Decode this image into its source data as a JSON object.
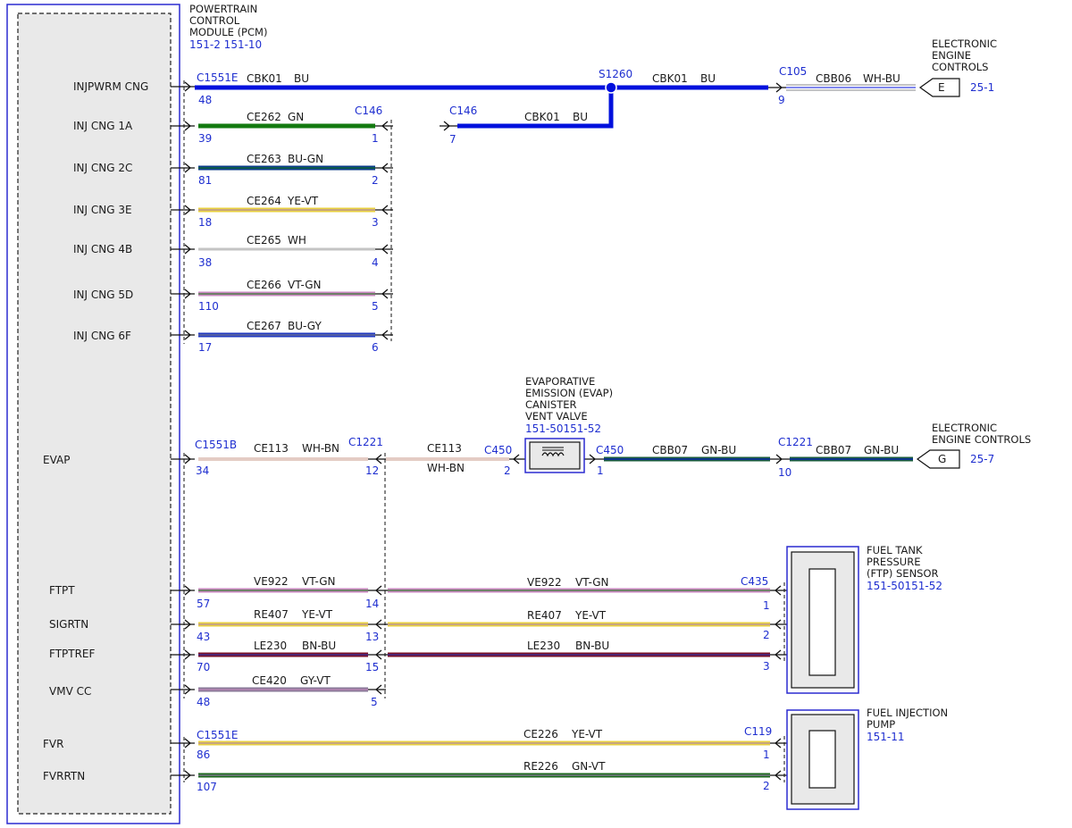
{
  "colors": {
    "blue": "#0010dd",
    "green": "#137a10",
    "blue_green": "#0a3a8a",
    "yellow": "#e8d040",
    "white": "#aaaaaa",
    "violet_green": "#c988c0",
    "blue_gray": "#2038c0",
    "white_brown": "#c89a88",
    "green_blue": "#1a5c3c",
    "brown_blue": "#7a1028",
    "gray_violet": "#8a7a98",
    "green_violet": "#1c6a1c",
    "label_blue": "#1f2fd0"
  },
  "pcm": {
    "title": [
      "POWERTRAIN",
      "CONTROL",
      "MODULE (PCM)"
    ],
    "ref": "151-2  151-10",
    "signals": [
      {
        "label": "INJPWRM CNG"
      },
      {
        "label": "INJ CNG 1A"
      },
      {
        "label": "INJ CNG 2C"
      },
      {
        "label": "INJ CNG 3E"
      },
      {
        "label": "INJ CNG 4B"
      },
      {
        "label": "INJ CNG 5D"
      },
      {
        "label": "INJ CNG 6F"
      },
      {
        "label": "EVAP"
      },
      {
        "label": "FTPT"
      },
      {
        "label": "SIGRTN"
      },
      {
        "label": "FTPTREF"
      },
      {
        "label": "VMV CC"
      },
      {
        "label": "FVR"
      },
      {
        "label": "FVRRTN"
      }
    ]
  },
  "connectors": {
    "c1551e_top": "C1551E",
    "c146_left": "C146",
    "c146_mid": "C146",
    "s1260": "S1260",
    "c105": "C105",
    "c1551b": "C1551B",
    "c1221_left": "C1221",
    "c450_left": "C450",
    "c450_right": "C450",
    "c1221_right": "C1221",
    "c435": "C435",
    "c1551e_bottom": "C1551E",
    "c119": "C119"
  },
  "wires": {
    "w1_left": {
      "circuit": "CBK01",
      "color": "BU",
      "pin": "48"
    },
    "w1_mid": {
      "circuit": "CBK01",
      "color": "BU"
    },
    "w1_right": {
      "circuit": "CBB06",
      "color": "WH-BU",
      "pin": "9"
    },
    "w1_branch": {
      "circuit": "CBK01",
      "color": "BU",
      "pin": "7"
    },
    "w2": {
      "circuit": "CE262",
      "color": "GN",
      "pin_left": "39",
      "pin_right": "1"
    },
    "w3": {
      "circuit": "CE263",
      "color": "BU-GN",
      "pin_left": "81",
      "pin_right": "2"
    },
    "w4": {
      "circuit": "CE264",
      "color": "YE-VT",
      "pin_left": "18",
      "pin_right": "3"
    },
    "w5": {
      "circuit": "CE265",
      "color": "WH",
      "pin_left": "38",
      "pin_right": "4"
    },
    "w6": {
      "circuit": "CE266",
      "color": "VT-GN",
      "pin_left": "110",
      "pin_right": "5"
    },
    "w7": {
      "circuit": "CE267",
      "color": "BU-GY",
      "pin_left": "17",
      "pin_right": "6"
    },
    "w8_left": {
      "circuit": "CE113",
      "color": "WH-BN",
      "pin_left": "34",
      "pin_right": "12"
    },
    "w8_mid": {
      "circuit": "CE113",
      "color": "WH-BN",
      "pin_right": "2"
    },
    "w8_right": {
      "circuit": "CBB07",
      "color": "GN-BU",
      "pin_left": "1"
    },
    "w8_far": {
      "circuit": "CBB07",
      "color": "GN-BU",
      "pin_left": "10"
    },
    "w9_left": {
      "circuit": "VE922",
      "color": "VT-GN",
      "pin_left": "57",
      "pin_right": "14"
    },
    "w9_right": {
      "circuit": "VE922",
      "color": "VT-GN",
      "pin_right": "1"
    },
    "w10_left": {
      "circuit": "RE407",
      "color": "YE-VT",
      "pin_left": "43",
      "pin_right": "13"
    },
    "w10_right": {
      "circuit": "RE407",
      "color": "YE-VT",
      "pin_right": "2"
    },
    "w11_left": {
      "circuit": "LE230",
      "color": "BN-BU",
      "pin_left": "70",
      "pin_right": "15"
    },
    "w11_right": {
      "circuit": "LE230",
      "color": "BN-BU",
      "pin_right": "3"
    },
    "w12": {
      "circuit": "CE420",
      "color": "GY-VT",
      "pin_left": "48",
      "pin_right": "5"
    },
    "w13": {
      "circuit": "CE226",
      "color": "YE-VT",
      "pin_left": "86",
      "pin_right": "1"
    },
    "w14": {
      "circuit": "RE226",
      "color": "GN-VT",
      "pin_left": "107",
      "pin_right": "2"
    }
  },
  "components": {
    "eec_top": {
      "title": [
        "ELECTRONIC",
        "ENGINE",
        "CONTROLS"
      ],
      "letter": "E",
      "ref": "25-1"
    },
    "evap_valve": {
      "title": [
        "EVAPORATIVE",
        "EMISSION (EVAP)",
        "CANISTER",
        "VENT VALVE"
      ],
      "ref": "151-50151-52"
    },
    "eec_mid": {
      "title": [
        "ELECTRONIC",
        "ENGINE CONTROLS"
      ],
      "letter": "G",
      "ref": "25-7"
    },
    "ftp_sensor": {
      "title": [
        "FUEL TANK",
        "PRESSURE",
        "(FTP) SENSOR"
      ],
      "ref": "151-50151-52"
    },
    "fuel_pump": {
      "title": [
        "FUEL INJECTION",
        "PUMP"
      ],
      "ref": "151-11"
    }
  }
}
